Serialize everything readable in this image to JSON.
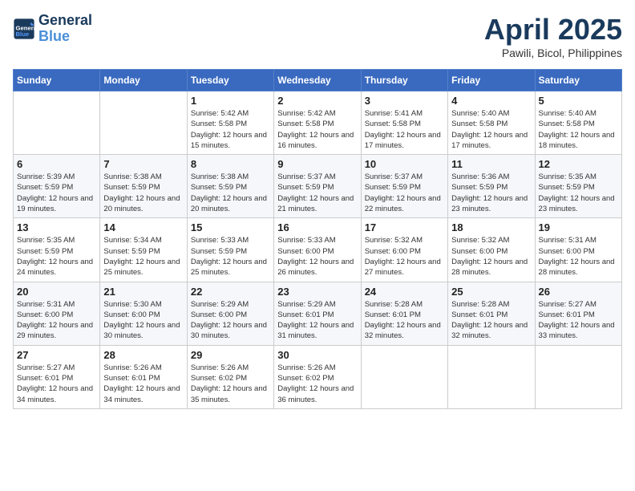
{
  "header": {
    "logo_line1": "General",
    "logo_line2": "Blue",
    "month_year": "April 2025",
    "location": "Pawili, Bicol, Philippines"
  },
  "weekdays": [
    "Sunday",
    "Monday",
    "Tuesday",
    "Wednesday",
    "Thursday",
    "Friday",
    "Saturday"
  ],
  "weeks": [
    [
      {
        "day": "",
        "info": ""
      },
      {
        "day": "",
        "info": ""
      },
      {
        "day": "1",
        "info": "Sunrise: 5:42 AM\nSunset: 5:58 PM\nDaylight: 12 hours and 15 minutes."
      },
      {
        "day": "2",
        "info": "Sunrise: 5:42 AM\nSunset: 5:58 PM\nDaylight: 12 hours and 16 minutes."
      },
      {
        "day": "3",
        "info": "Sunrise: 5:41 AM\nSunset: 5:58 PM\nDaylight: 12 hours and 17 minutes."
      },
      {
        "day": "4",
        "info": "Sunrise: 5:40 AM\nSunset: 5:58 PM\nDaylight: 12 hours and 17 minutes."
      },
      {
        "day": "5",
        "info": "Sunrise: 5:40 AM\nSunset: 5:58 PM\nDaylight: 12 hours and 18 minutes."
      }
    ],
    [
      {
        "day": "6",
        "info": "Sunrise: 5:39 AM\nSunset: 5:59 PM\nDaylight: 12 hours and 19 minutes."
      },
      {
        "day": "7",
        "info": "Sunrise: 5:38 AM\nSunset: 5:59 PM\nDaylight: 12 hours and 20 minutes."
      },
      {
        "day": "8",
        "info": "Sunrise: 5:38 AM\nSunset: 5:59 PM\nDaylight: 12 hours and 20 minutes."
      },
      {
        "day": "9",
        "info": "Sunrise: 5:37 AM\nSunset: 5:59 PM\nDaylight: 12 hours and 21 minutes."
      },
      {
        "day": "10",
        "info": "Sunrise: 5:37 AM\nSunset: 5:59 PM\nDaylight: 12 hours and 22 minutes."
      },
      {
        "day": "11",
        "info": "Sunrise: 5:36 AM\nSunset: 5:59 PM\nDaylight: 12 hours and 23 minutes."
      },
      {
        "day": "12",
        "info": "Sunrise: 5:35 AM\nSunset: 5:59 PM\nDaylight: 12 hours and 23 minutes."
      }
    ],
    [
      {
        "day": "13",
        "info": "Sunrise: 5:35 AM\nSunset: 5:59 PM\nDaylight: 12 hours and 24 minutes."
      },
      {
        "day": "14",
        "info": "Sunrise: 5:34 AM\nSunset: 5:59 PM\nDaylight: 12 hours and 25 minutes."
      },
      {
        "day": "15",
        "info": "Sunrise: 5:33 AM\nSunset: 5:59 PM\nDaylight: 12 hours and 25 minutes."
      },
      {
        "day": "16",
        "info": "Sunrise: 5:33 AM\nSunset: 6:00 PM\nDaylight: 12 hours and 26 minutes."
      },
      {
        "day": "17",
        "info": "Sunrise: 5:32 AM\nSunset: 6:00 PM\nDaylight: 12 hours and 27 minutes."
      },
      {
        "day": "18",
        "info": "Sunrise: 5:32 AM\nSunset: 6:00 PM\nDaylight: 12 hours and 28 minutes."
      },
      {
        "day": "19",
        "info": "Sunrise: 5:31 AM\nSunset: 6:00 PM\nDaylight: 12 hours and 28 minutes."
      }
    ],
    [
      {
        "day": "20",
        "info": "Sunrise: 5:31 AM\nSunset: 6:00 PM\nDaylight: 12 hours and 29 minutes."
      },
      {
        "day": "21",
        "info": "Sunrise: 5:30 AM\nSunset: 6:00 PM\nDaylight: 12 hours and 30 minutes."
      },
      {
        "day": "22",
        "info": "Sunrise: 5:29 AM\nSunset: 6:00 PM\nDaylight: 12 hours and 30 minutes."
      },
      {
        "day": "23",
        "info": "Sunrise: 5:29 AM\nSunset: 6:01 PM\nDaylight: 12 hours and 31 minutes."
      },
      {
        "day": "24",
        "info": "Sunrise: 5:28 AM\nSunset: 6:01 PM\nDaylight: 12 hours and 32 minutes."
      },
      {
        "day": "25",
        "info": "Sunrise: 5:28 AM\nSunset: 6:01 PM\nDaylight: 12 hours and 32 minutes."
      },
      {
        "day": "26",
        "info": "Sunrise: 5:27 AM\nSunset: 6:01 PM\nDaylight: 12 hours and 33 minutes."
      }
    ],
    [
      {
        "day": "27",
        "info": "Sunrise: 5:27 AM\nSunset: 6:01 PM\nDaylight: 12 hours and 34 minutes."
      },
      {
        "day": "28",
        "info": "Sunrise: 5:26 AM\nSunset: 6:01 PM\nDaylight: 12 hours and 34 minutes."
      },
      {
        "day": "29",
        "info": "Sunrise: 5:26 AM\nSunset: 6:02 PM\nDaylight: 12 hours and 35 minutes."
      },
      {
        "day": "30",
        "info": "Sunrise: 5:26 AM\nSunset: 6:02 PM\nDaylight: 12 hours and 36 minutes."
      },
      {
        "day": "",
        "info": ""
      },
      {
        "day": "",
        "info": ""
      },
      {
        "day": "",
        "info": ""
      }
    ]
  ]
}
